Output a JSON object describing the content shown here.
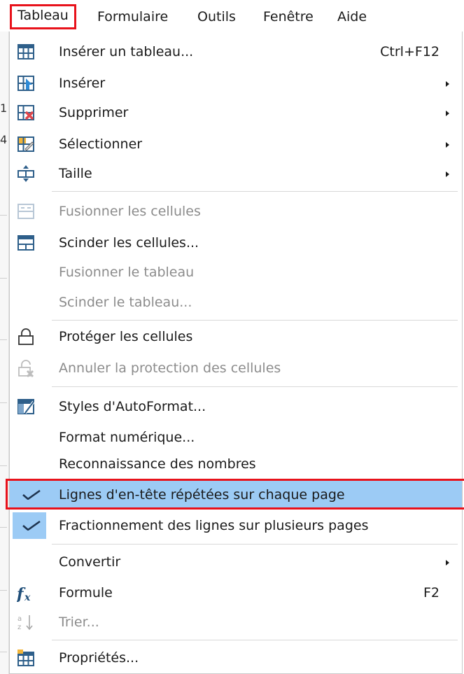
{
  "menubar": {
    "items": [
      "Tableau",
      "Formulaire",
      "Outils",
      "Fenêtre",
      "Aide"
    ],
    "active": "Tableau"
  },
  "doc_edge": {
    "chars": [
      "1",
      "4"
    ]
  },
  "menu": {
    "items": [
      {
        "label": "Insérer un tableau...",
        "shortcut": "Ctrl+F12",
        "icon": "insert-table-icon",
        "disabled": false
      },
      {
        "label": "Insérer",
        "submenu": true,
        "icon": "insert-rows-icon",
        "disabled": false
      },
      {
        "label": "Supprimer",
        "submenu": true,
        "icon": "delete-table-icon",
        "disabled": false
      },
      {
        "label": "Sélectionner",
        "submenu": true,
        "icon": "select-table-icon",
        "disabled": false
      },
      {
        "label": "Taille",
        "submenu": true,
        "icon": "size-icon",
        "disabled": false
      },
      {
        "label": "Fusionner les cellules",
        "icon": "merge-cells-icon",
        "disabled": true
      },
      {
        "label": "Scinder les cellules...",
        "icon": "split-cells-icon",
        "disabled": false
      },
      {
        "label": "Fusionner le tableau",
        "disabled": true
      },
      {
        "label": "Scinder le tableau...",
        "disabled": true
      },
      {
        "label": "Protéger les cellules",
        "icon": "lock-icon",
        "disabled": false
      },
      {
        "label": "Annuler la protection des cellules",
        "icon": "unlock-icon",
        "disabled": true
      },
      {
        "label": "Styles d'AutoFormat...",
        "icon": "autoformat-icon",
        "disabled": false
      },
      {
        "label": "Format numérique...",
        "disabled": false
      },
      {
        "label": "Reconnaissance des nombres",
        "disabled": false
      },
      {
        "label": "Lignes d'en-tête répétées sur chaque page",
        "checked": true,
        "highlighted": true,
        "disabled": false
      },
      {
        "label": "Fractionnement des lignes sur plusieurs pages",
        "checked": true,
        "disabled": false
      },
      {
        "label": "Convertir",
        "submenu": true,
        "disabled": false
      },
      {
        "label": "Formule",
        "shortcut": "F2",
        "icon": "formula-fx-icon",
        "disabled": false
      },
      {
        "label": "Trier...",
        "icon": "sort-az-icon",
        "disabled": true
      },
      {
        "label": "Propriétés...",
        "icon": "table-properties-icon",
        "disabled": false
      }
    ]
  },
  "colors": {
    "highlight": "#9ccbf5",
    "annotation_red": "#e8121b",
    "icon_blue": "#2e5f8a",
    "icon_red": "#e0454a",
    "icon_yellow": "#f2b53a"
  }
}
